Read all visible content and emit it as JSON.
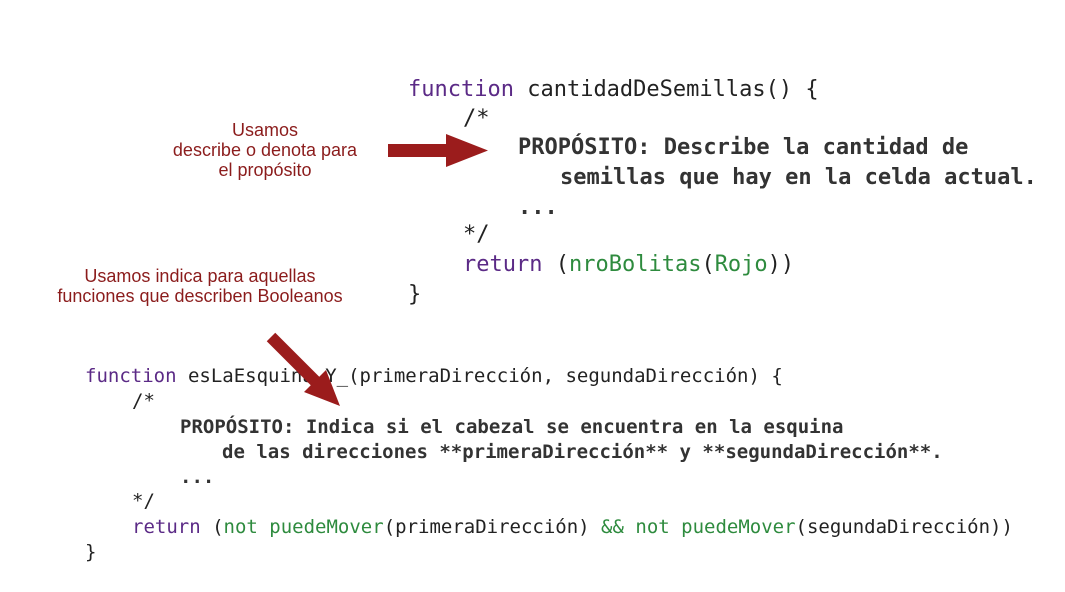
{
  "annotations": {
    "purpose_note": [
      "Usamos",
      "describe o denota para",
      "el propósito"
    ],
    "boolean_note": [
      "Usamos indica para aquellas",
      "funciones que describen Booleanos"
    ]
  },
  "code1": {
    "keyword_function": "function",
    "signature": " cantidadDeSemillas() {",
    "comment_open": "/*",
    "purpose_line1": "PROPÓSITO: Describe la cantidad de",
    "purpose_line2": "semillas que hay en la celda actual.",
    "ellipsis": "...",
    "comment_close": "*/",
    "keyword_return": "return",
    "ret_open": " (",
    "ret_fn": "nroBolitas",
    "ret_paren": "(",
    "ret_arg": "Rojo",
    "ret_close": "))",
    "close_brace": "}"
  },
  "code2": {
    "keyword_function": "function",
    "signature": " esLaEsquina_Y_(primeraDirección, segundaDirección) {",
    "comment_open": "/*",
    "purpose_line1": "PROPÓSITO: Indica si el cabezal se encuentra en la esquina",
    "purpose_line2": "de las direcciones **primeraDirección** y **segundaDirección**.",
    "ellipsis": "...",
    "comment_close": "*/",
    "keyword_return": "return",
    "ret_open": " (",
    "not1": "not",
    "fn1": " puedeMover",
    "arg1": "(primeraDirección) ",
    "and_op": "&&",
    "not2": " not",
    "fn2": " puedeMover",
    "arg2": "(segundaDirección))",
    "close_brace": "}"
  },
  "colors": {
    "keyword": "#5b2a86",
    "builtin": "#2e8b3e",
    "annotation": "#8b1c1c",
    "arrow": "#9b1c1c"
  }
}
